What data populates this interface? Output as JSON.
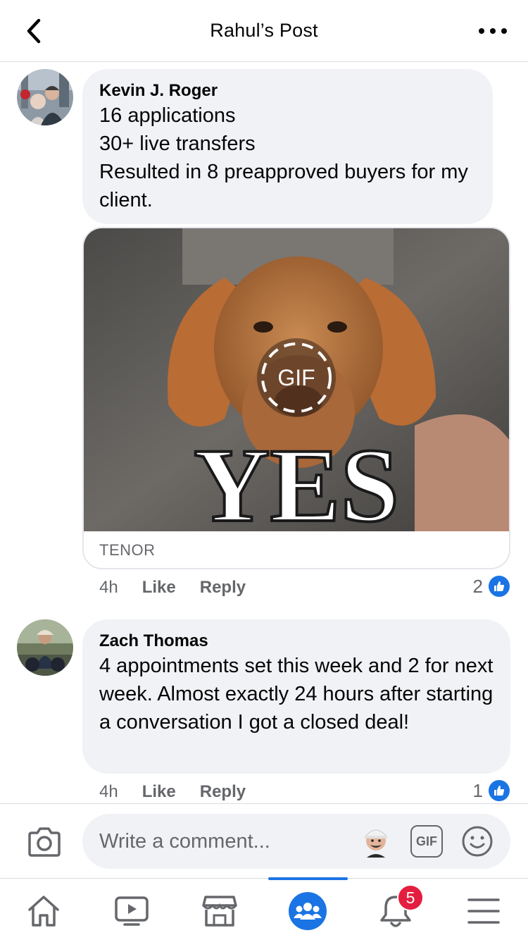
{
  "header": {
    "title": "Rahul’s Post"
  },
  "comments": [
    {
      "author": "Kevin J. Roger",
      "text": "16 applications\n30+ live transfers\nResulted in 8 preapproved buyers for my client.",
      "gif": {
        "caption_text": "YES",
        "badge_label": "GIF",
        "source": "TENOR"
      },
      "time": "4h",
      "like_label": "Like",
      "reply_label": "Reply",
      "reaction_count": "2"
    },
    {
      "author": "Zach Thomas",
      "text": "4 appointments set this week and 2 for next week. Almost exactly 24 hours after starting a conversation I got a closed deal!",
      "time": "4h",
      "like_label": "Like",
      "reply_label": "Reply",
      "reaction_count": "1"
    }
  ],
  "composer": {
    "placeholder": "Write a comment...",
    "gif_label": "GIF"
  },
  "nav": {
    "notifications_badge": "5",
    "items": [
      "home-icon",
      "watch-icon",
      "marketplace-icon",
      "groups-icon",
      "notifications-icon",
      "menu-icon"
    ]
  },
  "colors": {
    "accent": "#1b74e4",
    "bubble": "#f0f2f5",
    "badge": "#e41e3f",
    "secondary_text": "#65676b"
  }
}
